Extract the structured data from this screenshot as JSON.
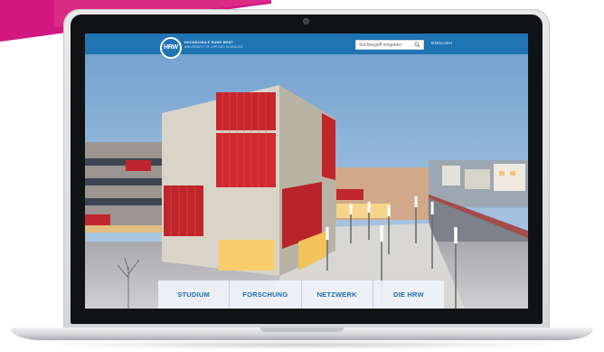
{
  "header": {
    "logo_text": "HRW",
    "logo_line1": "HOCHSCHULE RUHR WEST",
    "logo_line2": "UNIVERSITY OF APPLIED SCIENCES",
    "search_placeholder": "Suchbegriff eingeben",
    "language_link": "ENGLISH"
  },
  "nav": {
    "items": [
      {
        "label": "STUDIUM"
      },
      {
        "label": "FORSCHUNG"
      },
      {
        "label": "NETZWERK"
      },
      {
        "label": "DIE HRW"
      }
    ]
  },
  "colors": {
    "brand_blue": "#1f74b4",
    "accent_magenta": "#d2177f",
    "facade_red": "#c8262b"
  }
}
